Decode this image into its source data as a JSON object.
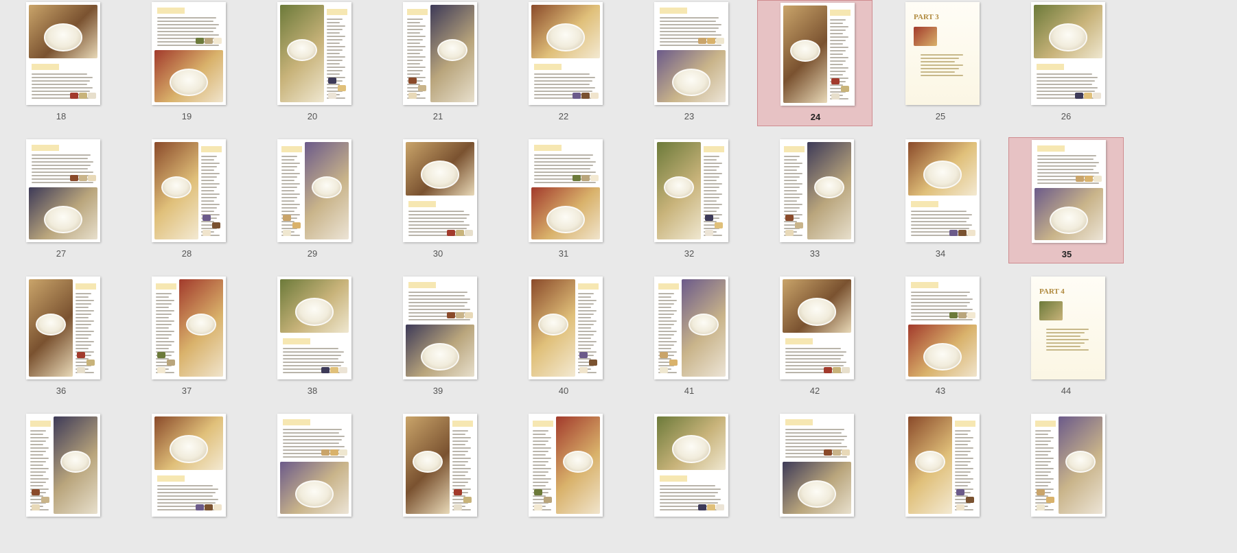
{
  "panel": "page-thumbnails",
  "selected_pages": [
    24,
    35
  ],
  "pages": [
    {
      "number": "18"
    },
    {
      "number": "19"
    },
    {
      "number": "20"
    },
    {
      "number": "21"
    },
    {
      "number": "22"
    },
    {
      "number": "23"
    },
    {
      "number": "24"
    },
    {
      "number": "25"
    },
    {
      "number": "26"
    },
    {
      "number": "27"
    },
    {
      "number": "28"
    },
    {
      "number": "29"
    },
    {
      "number": "30"
    },
    {
      "number": "31"
    },
    {
      "number": "32"
    },
    {
      "number": "33"
    },
    {
      "number": "34"
    },
    {
      "number": "35"
    },
    {
      "number": "36"
    },
    {
      "number": "37"
    },
    {
      "number": "38"
    },
    {
      "number": "39"
    },
    {
      "number": "40"
    },
    {
      "number": "41"
    },
    {
      "number": "42"
    },
    {
      "number": "43"
    },
    {
      "number": "44"
    },
    {
      "number": ""
    },
    {
      "number": ""
    },
    {
      "number": ""
    },
    {
      "number": ""
    },
    {
      "number": ""
    },
    {
      "number": ""
    },
    {
      "number": ""
    },
    {
      "number": ""
    },
    {
      "number": ""
    }
  ],
  "colors": {
    "background": "#e9e9e9",
    "selection_fill": "#e7c2c4",
    "selection_border": "#cf8b8f",
    "page_number": "#555555"
  },
  "page_titles": {
    "25": "PART 3",
    "44": "PART 4"
  }
}
